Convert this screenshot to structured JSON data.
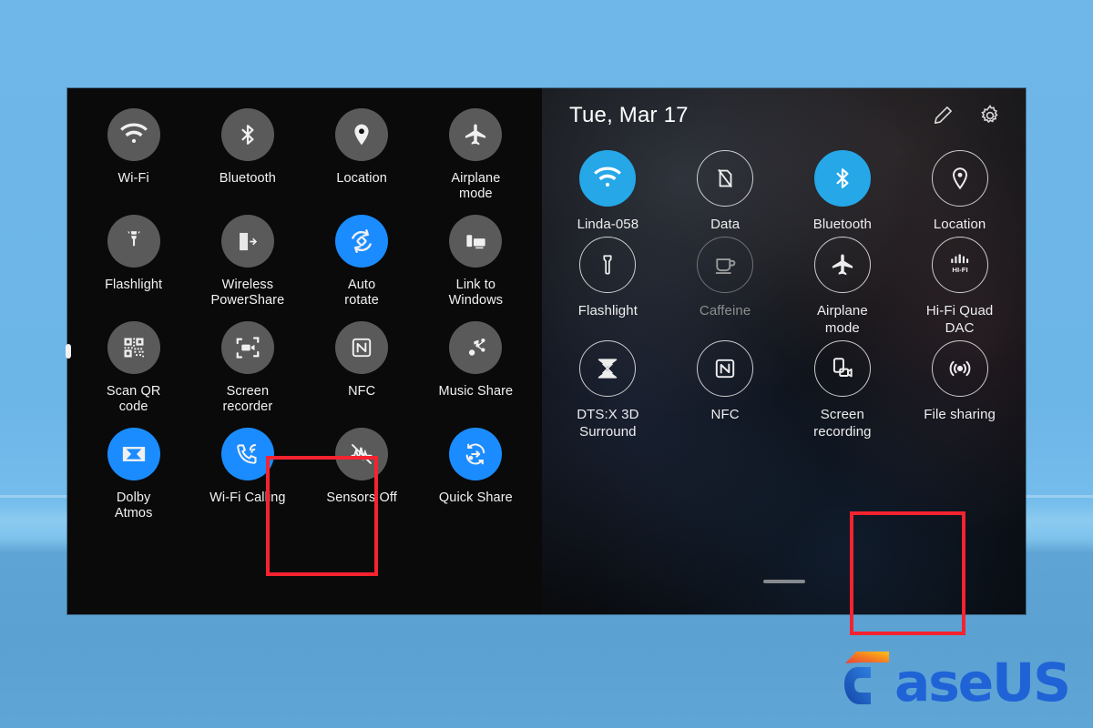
{
  "background": {
    "top_color": "#6fb7e8",
    "bottom_color": "#5ba1d2"
  },
  "left_panel": {
    "name": "Samsung quick settings panel",
    "background": "#0a0a0a",
    "active_color": "#1a8cff",
    "inactive_color": "#5a5a5a",
    "tiles": [
      {
        "label": "Wi-Fi",
        "icon": "wifi-icon",
        "state": "off"
      },
      {
        "label": "Bluetooth",
        "icon": "bluetooth-icon",
        "state": "off"
      },
      {
        "label": "Location",
        "icon": "location-pin-icon",
        "state": "off"
      },
      {
        "label": "Airplane\nmode",
        "icon": "airplane-icon",
        "state": "off"
      },
      {
        "label": "Flashlight",
        "icon": "flashlight-icon",
        "state": "off"
      },
      {
        "label": "Wireless\nPowerShare",
        "icon": "wireless-powershare-icon",
        "state": "off"
      },
      {
        "label": "Auto\nrotate",
        "icon": "auto-rotate-icon",
        "state": "on"
      },
      {
        "label": "Link to\nWindows",
        "icon": "link-to-windows-icon",
        "state": "off"
      },
      {
        "label": "Scan QR\ncode",
        "icon": "qr-code-icon",
        "state": "off"
      },
      {
        "label": "Screen\nrecorder",
        "icon": "screen-recorder-icon",
        "state": "off"
      },
      {
        "label": "NFC",
        "icon": "nfc-icon",
        "state": "off"
      },
      {
        "label": "Music Share",
        "icon": "music-share-icon",
        "state": "off"
      },
      {
        "label": "Dolby\nAtmos",
        "icon": "dolby-atmos-icon",
        "state": "on"
      },
      {
        "label": "Wi-Fi Calling",
        "icon": "wifi-calling-icon",
        "state": "on"
      },
      {
        "label": "Sensors Off",
        "icon": "sensors-off-icon",
        "state": "off"
      },
      {
        "label": "Quick Share",
        "icon": "quick-share-icon",
        "state": "on"
      }
    ]
  },
  "right_panel": {
    "name": "LG quick settings panel",
    "date": "Tue, Mar 17",
    "active_color": "#25a7e8",
    "actions": [
      {
        "name": "edit-pencil-icon",
        "label": "Edit"
      },
      {
        "name": "gear-icon",
        "label": "Settings"
      }
    ],
    "tiles": [
      {
        "label": "Linda-058",
        "icon": "wifi-icon",
        "state": "on"
      },
      {
        "label": "Data",
        "icon": "mobile-data-off-icon",
        "state": "off"
      },
      {
        "label": "Bluetooth",
        "icon": "bluetooth-icon",
        "state": "on"
      },
      {
        "label": "Location",
        "icon": "location-pin-icon",
        "state": "off"
      },
      {
        "label": "Flashlight",
        "icon": "flashlight-icon",
        "state": "off"
      },
      {
        "label": "Caffeine",
        "icon": "coffee-cup-icon",
        "state": "disabled"
      },
      {
        "label": "Airplane\nmode",
        "icon": "airplane-icon",
        "state": "off"
      },
      {
        "label": "Hi-Fi Quad\nDAC",
        "icon": "hifi-quad-dac-icon",
        "state": "off"
      },
      {
        "label": "DTS:X 3D\nSurround",
        "icon": "dtsx-icon",
        "state": "off"
      },
      {
        "label": "NFC",
        "icon": "nfc-icon",
        "state": "off"
      },
      {
        "label": "Screen\nrecording",
        "icon": "screen-recording-icon",
        "state": "off"
      },
      {
        "label": "File sharing",
        "icon": "file-sharing-icon",
        "state": "off"
      }
    ]
  },
  "annotations": {
    "color": "#f5232f",
    "boxes": [
      {
        "target": "Screen recorder",
        "panel": "left"
      },
      {
        "target": "Screen recording",
        "panel": "right"
      }
    ]
  },
  "watermark": {
    "text": "aseUS",
    "full_text": "EaseUS",
    "text_color": "#1f63d6",
    "accent_color": "#f59a1f"
  }
}
